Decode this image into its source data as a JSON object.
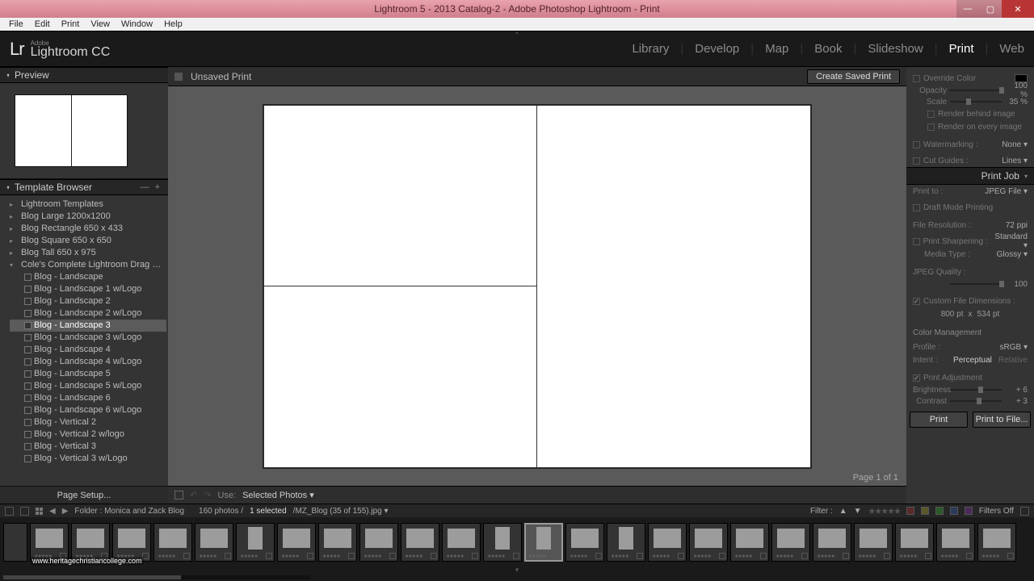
{
  "window": {
    "title": "Lightroom 5 - 2013 Catalog-2 - Adobe Photoshop Lightroom - Print"
  },
  "menu": [
    "File",
    "Edit",
    "Print",
    "View",
    "Window",
    "Help"
  ],
  "logo": {
    "small": "Adobe",
    "main": "Lightroom CC"
  },
  "modules": [
    "Library",
    "Develop",
    "Map",
    "Book",
    "Slideshow",
    "Print",
    "Web"
  ],
  "active_module": "Print",
  "left": {
    "preview_title": "Preview",
    "template_title": "Template Browser",
    "page_setup": "Page Setup...",
    "folders": [
      "Lightroom Templates",
      "Blog Large 1200x1200",
      "Blog Rectangle 650 x 433",
      "Blog Square 650 x 650",
      "Blog Tall 650 x 975",
      "Cole's Complete Lightroom Drag & Drop T..."
    ],
    "templates": [
      "Blog - Landscape",
      "Blog - Landscape 1 w/Logo",
      "Blog - Landscape 2",
      "Blog - Landscape 2 w/Logo",
      "Blog - Landscape 3",
      "Blog - Landscape 3 w/Logo",
      "Blog - Landscape 4",
      "Blog - Landscape 4 w/Logo",
      "Blog - Landscape 5",
      "Blog - Landscape 5 w/Logo",
      "Blog - Landscape 6",
      "Blog - Landscape 6 w/Logo",
      "Blog - Vertical 2",
      "Blog - Vertical 2 w/logo",
      "Blog - Vertical 3",
      "Blog - Vertical 3 w/Logo"
    ],
    "selected_template_index": 4
  },
  "center": {
    "title": "Unsaved Print",
    "create_btn": "Create Saved Print",
    "use_label": "Use:",
    "use_value": "Selected Photos",
    "page_info": "Page 1 of 1"
  },
  "right": {
    "override_color": "Override Color",
    "opacity_label": "Opacity",
    "opacity_val": "100 %",
    "scale_label": "Scale",
    "scale_val": "35 %",
    "render_behind": "Render behind image",
    "render_every": "Render on every image",
    "watermarking": "Watermarking :",
    "watermarking_val": "None ▾",
    "cut_guides": "Cut Guides :",
    "cut_guides_val": "Lines ▾",
    "printjob_title": "Print Job",
    "print_to": "Print to :",
    "print_to_val": "JPEG File ▾",
    "draft": "Draft Mode Printing",
    "file_res": "File Resolution :",
    "file_res_val": "72 ppi",
    "sharpen": "Print Sharpening :",
    "sharpen_val": "Standard ▾",
    "media": "Media Type :",
    "media_val": "Glossy ▾",
    "jpeg_q": "JPEG Quality :",
    "jpeg_q_val": "100",
    "custom_dim": "Custom File Dimensions :",
    "dim_w": "800 pt",
    "dim_x": "x",
    "dim_h": "534 pt",
    "color_mgmt": "Color Management",
    "profile": "Profile :",
    "profile_val": "sRGB ▾",
    "intent": "Intent :",
    "intent_a": "Perceptual",
    "intent_b": "Relative",
    "print_adj": "Print Adjustment",
    "brightness": "Brightness",
    "brightness_val": "+ 6",
    "contrast": "Contrast",
    "contrast_val": "+ 3",
    "print_btn": "Print",
    "print_file_btn": "Print to File..."
  },
  "filmstrip_header": {
    "path": "Folder : Monica and Zack Blog",
    "count": "160 photos /",
    "selected": "1 selected",
    "filename": "/MZ_Blog (35 of 155).jpg ▾",
    "filter": "Filter :",
    "filters_off": "Filters Off"
  },
  "watermark": "www.heritagechristiancollege.com"
}
